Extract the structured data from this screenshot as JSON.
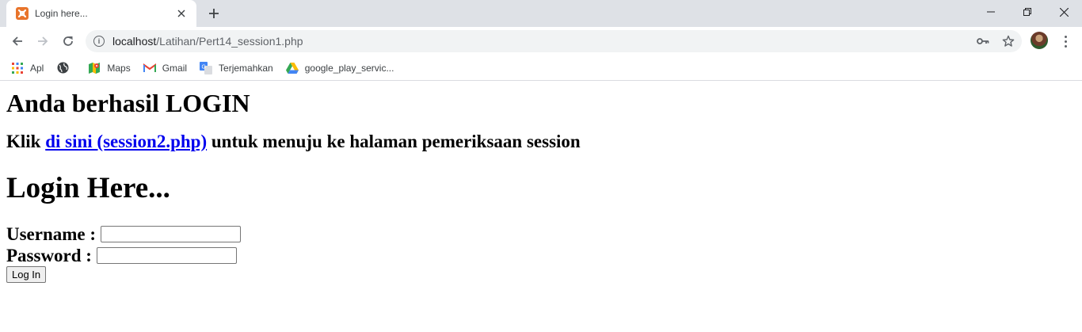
{
  "browser": {
    "tab_title": "Login here...",
    "url_host": "localhost",
    "url_path": "/Latihan/Pert14_session1.php",
    "bookmarks": [
      {
        "label": "Apl",
        "icon": "apps-grid-icon"
      },
      {
        "label": "",
        "icon": "globe-icon"
      },
      {
        "label": "Maps",
        "icon": "maps-icon"
      },
      {
        "label": "Gmail",
        "icon": "gmail-icon"
      },
      {
        "label": "Terjemahkan",
        "icon": "translate-icon"
      },
      {
        "label": "google_play_servic...",
        "icon": "drive-icon"
      }
    ]
  },
  "page": {
    "success_heading": "Anda berhasil LOGIN",
    "klik_prefix": "Klik",
    "link_text": "di sini (session2.php)",
    "klik_suffix": "untuk menuju ke halaman pemeriksaan session",
    "form_title": "Login Here...",
    "username_label": "Username :",
    "username_value": "",
    "password_label": "Password :",
    "password_value": "",
    "login_button": "Log In"
  },
  "colors": {
    "link": "#0000ee",
    "tab_strip": "#dee1e6",
    "favicon": "#e8742b"
  }
}
